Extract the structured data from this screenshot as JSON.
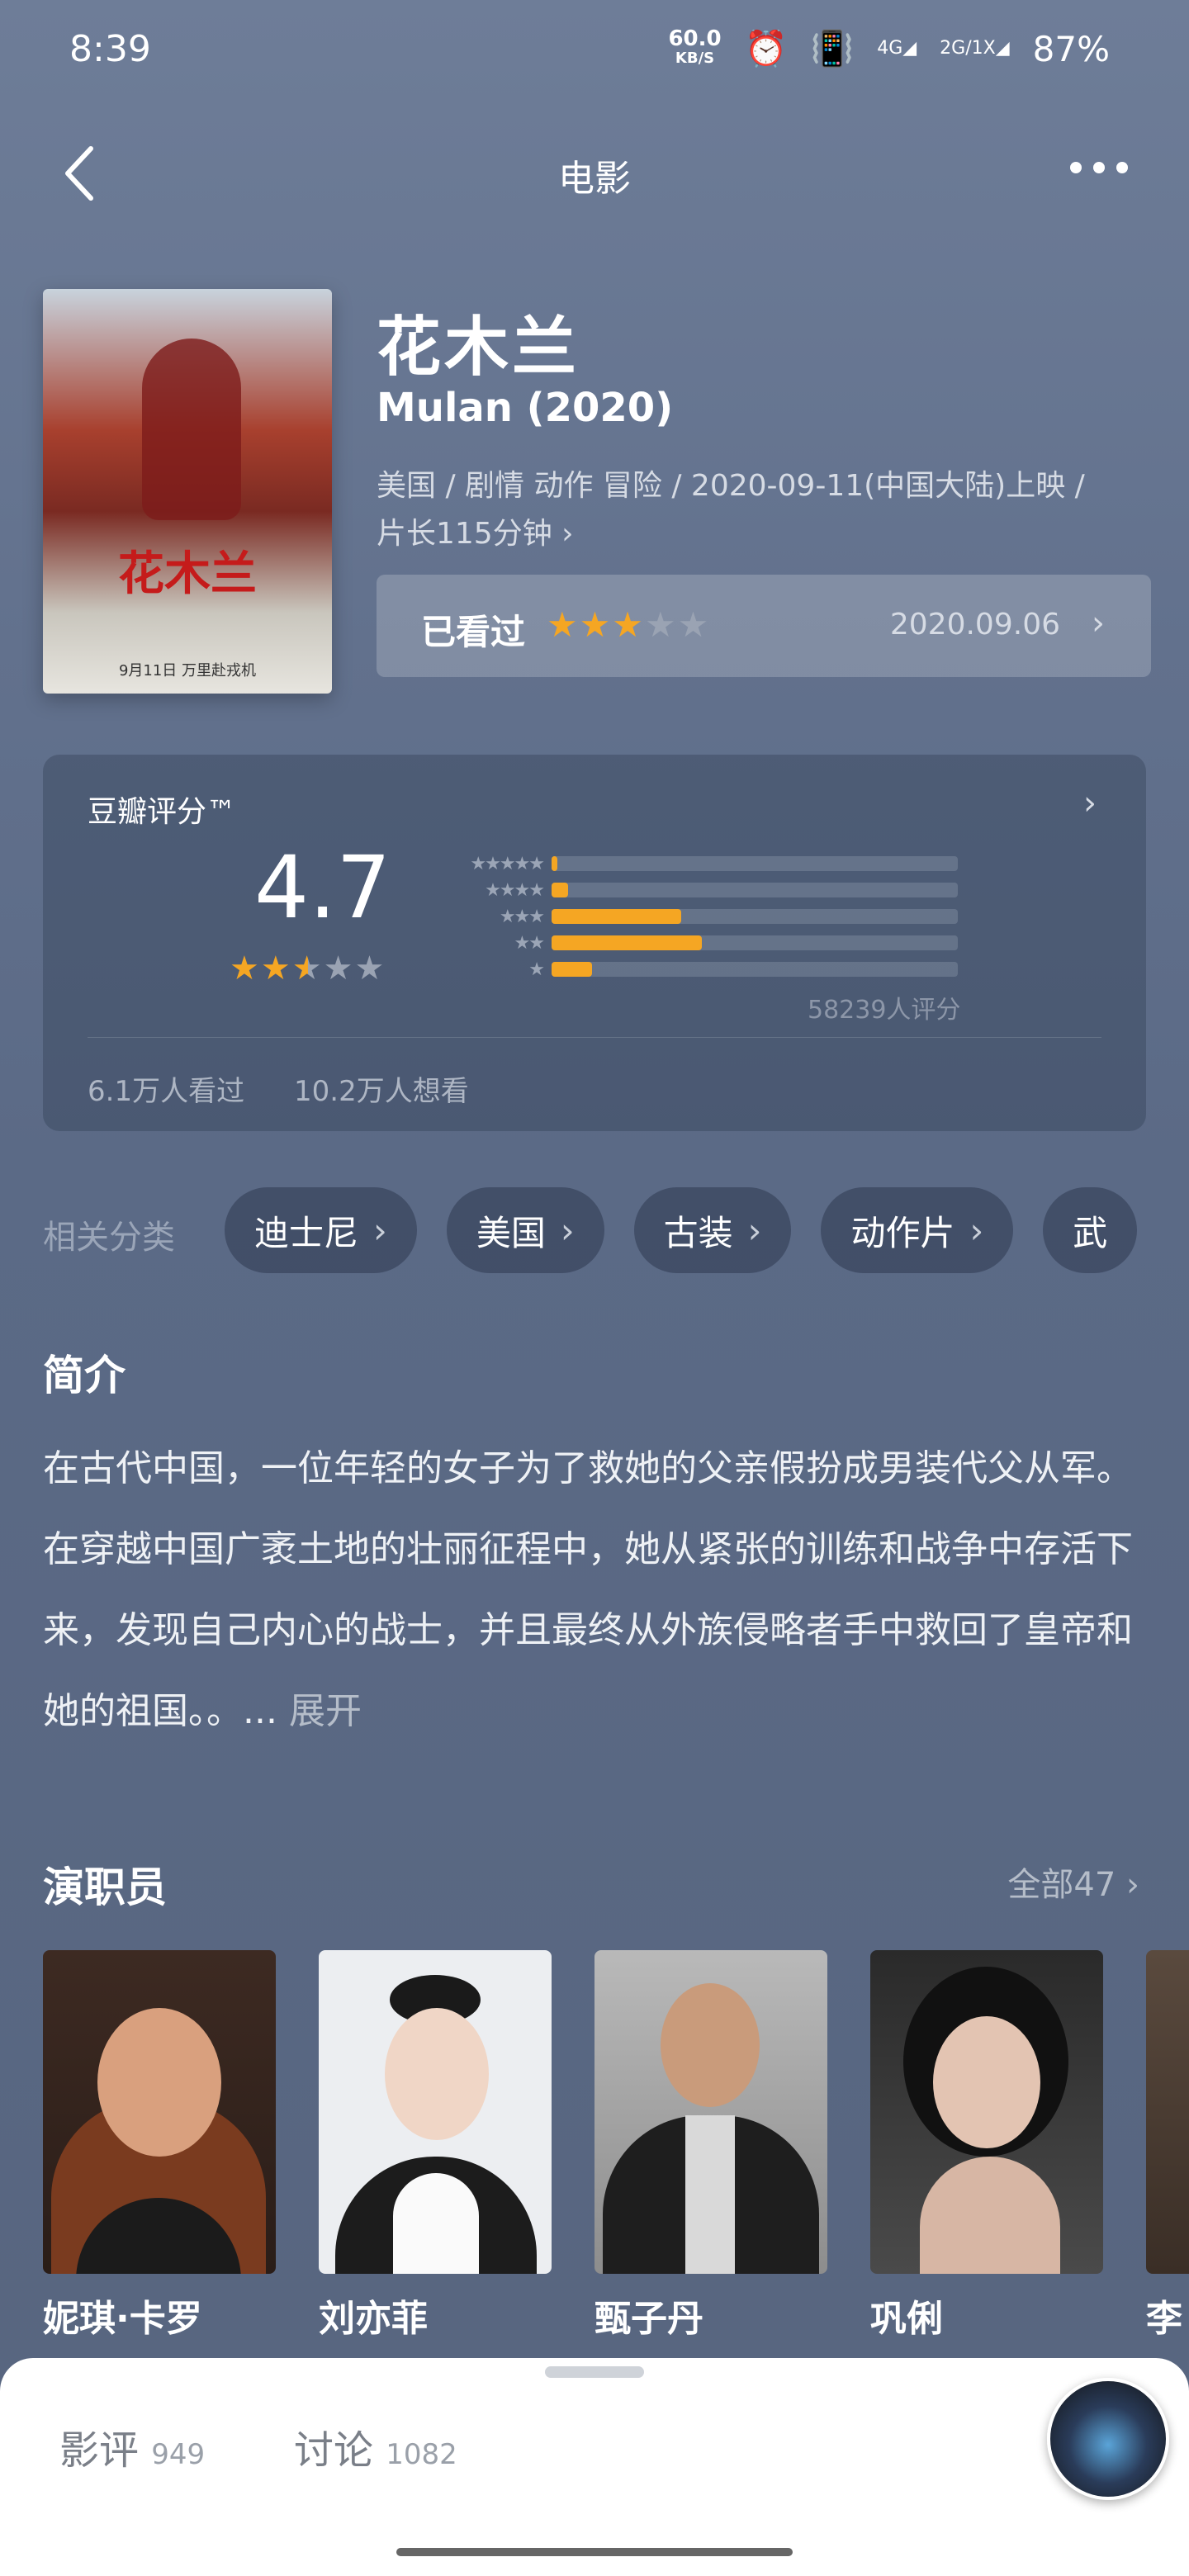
{
  "status": {
    "time": "8:39",
    "net_speed": "60.0",
    "net_unit": "KB/S",
    "net1": "4G",
    "net2a": "2G",
    "net2b": "1X",
    "battery": "87%"
  },
  "header": {
    "title": "电影"
  },
  "movie": {
    "title_cn": "花木兰",
    "title_en": "Mulan (2020)",
    "meta_line1": "美国 / 剧情 动作 冒险 / 2020-09-11(中国大陆)上映 /",
    "meta_line2": "片长115分钟 ›",
    "poster_title": "花木兰",
    "poster_date": "9月11日  万里赴戎机"
  },
  "watched": {
    "label": "已看过",
    "stars_on": 3,
    "date": "2020.09.06"
  },
  "rating": {
    "label": "豆瓣评分™",
    "score": "4.7",
    "stars": 2.5,
    "distribution": [
      {
        "stars": "★★★★★",
        "pct": 0.015
      },
      {
        "stars": "★★★★",
        "pct": 0.04
      },
      {
        "stars": "★★★",
        "pct": 0.32
      },
      {
        "stars": "★★",
        "pct": 0.37
      },
      {
        "stars": "★",
        "pct": 0.1
      }
    ],
    "count": "58239人评分",
    "seen": "6.1万人看过",
    "want": "10.2万人想看"
  },
  "categories": {
    "label": "相关分类",
    "items": [
      "迪士尼",
      "美国",
      "古装",
      "动作片",
      "武"
    ]
  },
  "intro": {
    "title": "简介",
    "text": "在古代中国，一位年轻的女子为了救她的父亲假扮成男装代父从军。在穿越中国广袤土地的壮丽征程中，她从紧张的训练和战争中存活下来，发现自己内心的战士，并且最终从外族侵略者手中救回了皇帝和她的祖国。。... ",
    "expand": "展开"
  },
  "cast": {
    "title": "演职员",
    "all": "全部47 ›",
    "members": [
      {
        "name": "妮琪·卡罗"
      },
      {
        "name": "刘亦菲"
      },
      {
        "name": "甄子丹"
      },
      {
        "name": "巩俐"
      },
      {
        "name": "李"
      }
    ]
  },
  "sheet": {
    "tab1": "影评",
    "tab1_count": "949",
    "tab2": "讨论",
    "tab2_count": "1082"
  },
  "colors": {
    "star_on": "#f5a623",
    "star_off": "#9aa3b3",
    "bg": "#5b6a86"
  }
}
